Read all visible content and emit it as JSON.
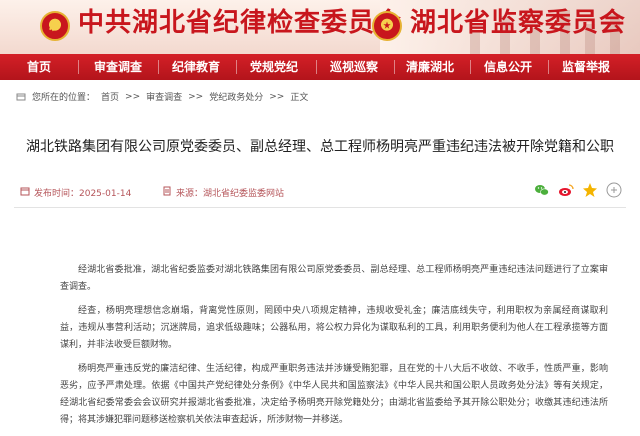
{
  "header": {
    "title_left": "中共湖北省纪律检查委员会",
    "title_right": "湖北省监察委员会"
  },
  "nav": {
    "items": [
      "首页",
      "审查调查",
      "纪律教育",
      "党规党纪",
      "巡视巡察",
      "清廉湖北",
      "信息公开",
      "监督举报"
    ]
  },
  "breadcrumb": {
    "prefix": "您所在的位置：",
    "items": [
      "首页",
      "审查调查",
      "党纪政务处分",
      "正文"
    ],
    "separator": ">>"
  },
  "article": {
    "title": "湖北铁路集团有限公司原党委委员、副总经理、总工程师杨明亮严重违纪违法被开除党籍和公职",
    "date_label": "发布时间：2025-01-14",
    "source_label": "来源：湖北省纪委监委网站",
    "paragraphs": [
      "经湖北省委批准，湖北省纪委监委对湖北铁路集团有限公司原党委委员、副总经理、总工程师杨明亮严重违纪违法问题进行了立案审查调查。",
      "经查，杨明亮理想信念崩塌，背离党性原则，罔顾中央八项规定精神，违规收受礼金；廉洁底线失守，利用职权为亲属经商谋取利益，违规从事营利活动；沉迷牌局，追求低级趣味；公器私用，将公权力异化为谋取私利的工具，利用职务便利为他人在工程承揽等方面谋利，并非法收受巨额财物。",
      "杨明亮严重违反党的廉洁纪律、生活纪律，构成严重职务违法并涉嫌受贿犯罪，且在党的十八大后不收敛、不收手，性质严重，影响恶劣，应予严肃处理。依据《中国共产党纪律处分条例》《中华人民共和国监察法》《中华人民共和国公职人员政务处分法》等有关规定，经湖北省纪委常委会会议研究并报湖北省委批准，决定给予杨明亮开除党籍处分；由湖北省监委给予其开除公职处分；收缴其违纪违法所得；将其涉嫌犯罪问题移送检察机关依法审查起诉，所涉财物一并移送。"
    ]
  },
  "colors": {
    "brand_red": "#c8161d",
    "nav_red": "#c41a22",
    "meta_text": "#b5555a"
  },
  "icons": {
    "share": [
      "wechat-icon",
      "weibo-icon",
      "qzone-icon",
      "more-share-icon"
    ]
  }
}
